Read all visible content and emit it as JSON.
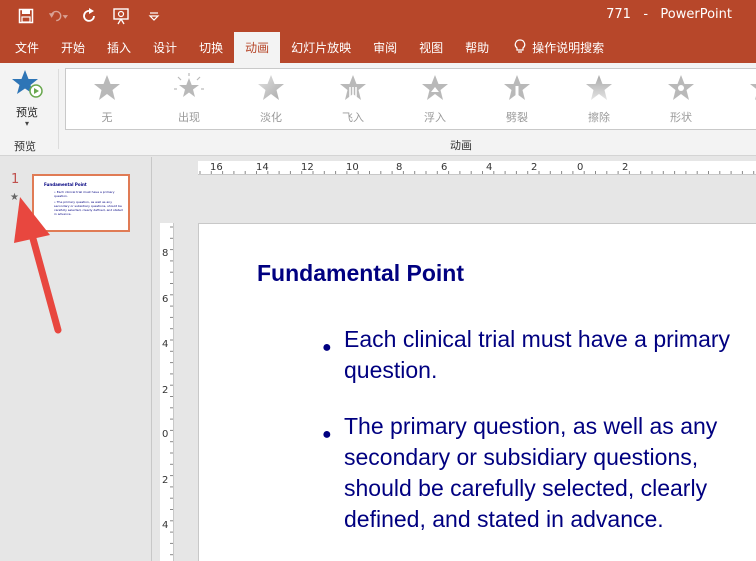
{
  "window": {
    "title": "771   -   PowerPoint"
  },
  "quick_access": [
    {
      "name": "save-icon"
    },
    {
      "name": "undo-icon"
    },
    {
      "name": "redo-icon"
    },
    {
      "name": "present-from-start-icon"
    },
    {
      "name": "customize-qat-icon"
    }
  ],
  "tabs": [
    {
      "label": "文件",
      "active": false
    },
    {
      "label": "开始",
      "active": false
    },
    {
      "label": "插入",
      "active": false
    },
    {
      "label": "设计",
      "active": false
    },
    {
      "label": "切换",
      "active": false
    },
    {
      "label": "动画",
      "active": true
    },
    {
      "label": "幻灯片放映",
      "active": false
    },
    {
      "label": "审阅",
      "active": false
    },
    {
      "label": "视图",
      "active": false
    },
    {
      "label": "帮助",
      "active": false
    }
  ],
  "tell_me": {
    "label": "操作说明搜索",
    "icon": "lightbulb-icon"
  },
  "ribbon": {
    "preview": {
      "button_label": "预览",
      "group_label": "预览"
    },
    "animations_group_label": "动画",
    "animations": [
      {
        "label": "无",
        "icon": "star-none-icon"
      },
      {
        "label": "出现",
        "icon": "star-appear-icon"
      },
      {
        "label": "淡化",
        "icon": "star-fade-icon"
      },
      {
        "label": "飞入",
        "icon": "star-fly-in-icon"
      },
      {
        "label": "浮入",
        "icon": "star-float-in-icon"
      },
      {
        "label": "劈裂",
        "icon": "star-split-icon"
      },
      {
        "label": "擦除",
        "icon": "star-wipe-icon"
      },
      {
        "label": "形状",
        "icon": "star-shape-icon"
      }
    ]
  },
  "slide_pane": {
    "slide_number": "1",
    "anim_marker": "★",
    "thumb_title": "Fundamental Point",
    "thumb_b1": "• Each clinical trial must have a primary question.",
    "thumb_b2": "• The primary question, as well as any secondary or subsidiary questions, should be carefully selected, clearly defined, and stated in advance."
  },
  "rulers": {
    "horizontal": [
      "16",
      "14",
      "12",
      "10",
      "8",
      "6",
      "4",
      "2",
      "0",
      "2"
    ],
    "vertical": [
      "8",
      "6",
      "4",
      "2",
      "0",
      "2",
      "4"
    ]
  },
  "slide": {
    "title": "Fundamental Point",
    "bullets": [
      {
        "lines": [
          "Each clinical trial must have a primary",
          "question."
        ]
      },
      {
        "lines": [
          "The primary question, as well as any",
          "secondary or subsidiary questions,",
          "should be carefully selected, clearly",
          "defined, and stated in advance."
        ]
      }
    ]
  },
  "colors": {
    "accent": "#b7472a",
    "slide_text": "#000080",
    "arrow": "#e8473f"
  }
}
